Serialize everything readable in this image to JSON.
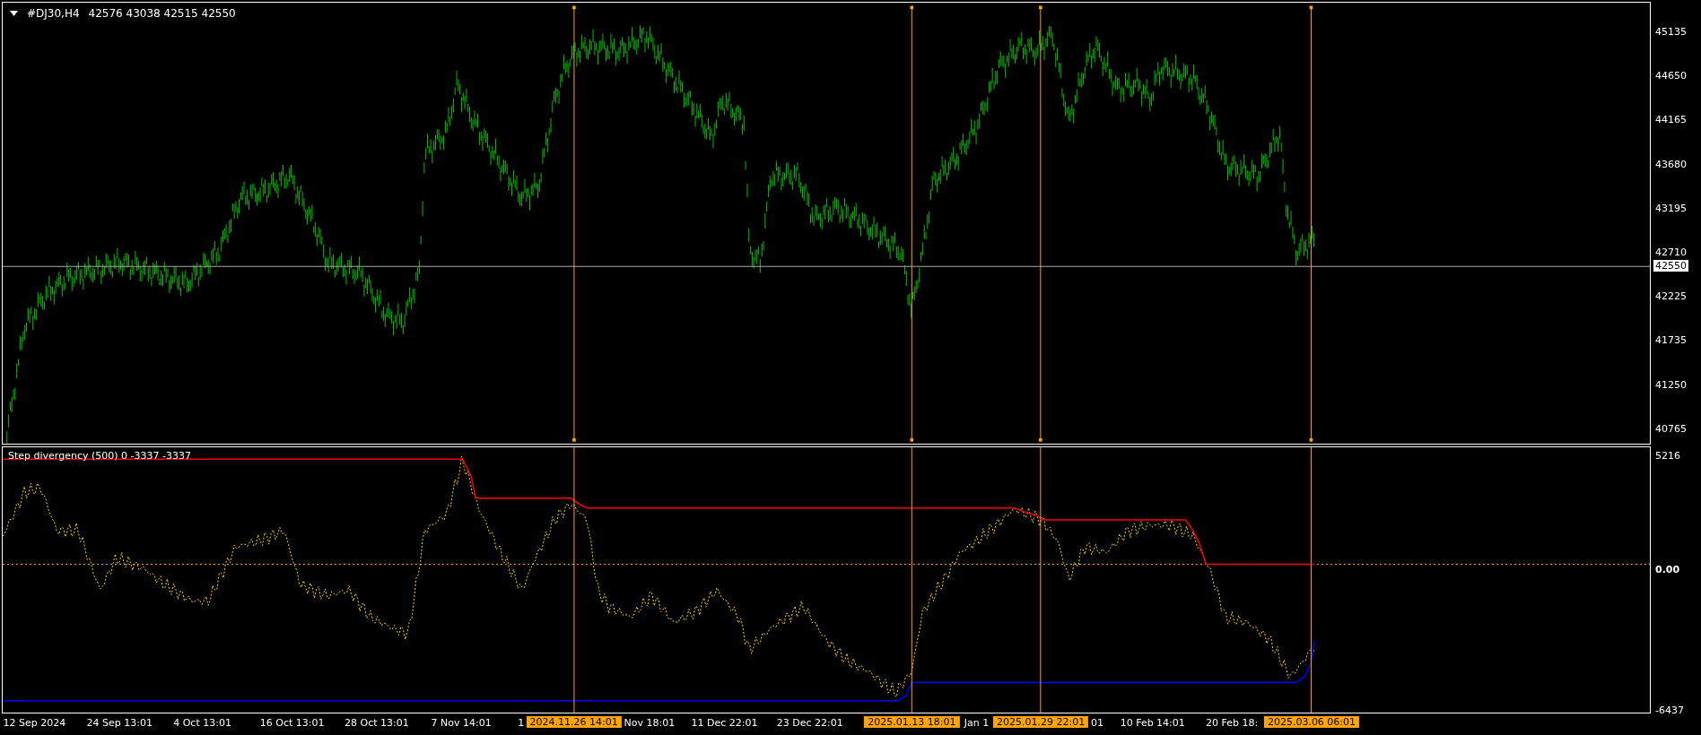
{
  "chart": {
    "symbol": "#DJ30,H4",
    "ohlc": "42576 43038 42515 42550",
    "price_axis": [
      "45135",
      "44650",
      "44165",
      "43680",
      "43195",
      "42710",
      "42225",
      "41735",
      "41250",
      "40765"
    ],
    "current_price": "42550"
  },
  "indicator": {
    "label": "Step divergency (500) 0 -3337 -3337",
    "axis": [
      "5216",
      "0.00",
      "-6437"
    ]
  },
  "time_axis": [
    "12 Sep 2024",
    "24 Sep 13:01",
    "4 Oct 13:01",
    "16 Oct 13:01",
    "28 Oct 13:01",
    "7 Nov 14:01",
    "1",
    "Nov 18:01",
    "11 Dec 22:01",
    "23 Dec 22:01",
    "Jan 1",
    "01",
    "10 Feb 14:01",
    "20 Feb 18:"
  ],
  "markers": [
    {
      "time": "2024.11.26 14:01"
    },
    {
      "time": "2025.01.13 18:01"
    },
    {
      "time": "2025.01.29 22:01"
    },
    {
      "time": "2025.03.06 06:01"
    }
  ]
}
